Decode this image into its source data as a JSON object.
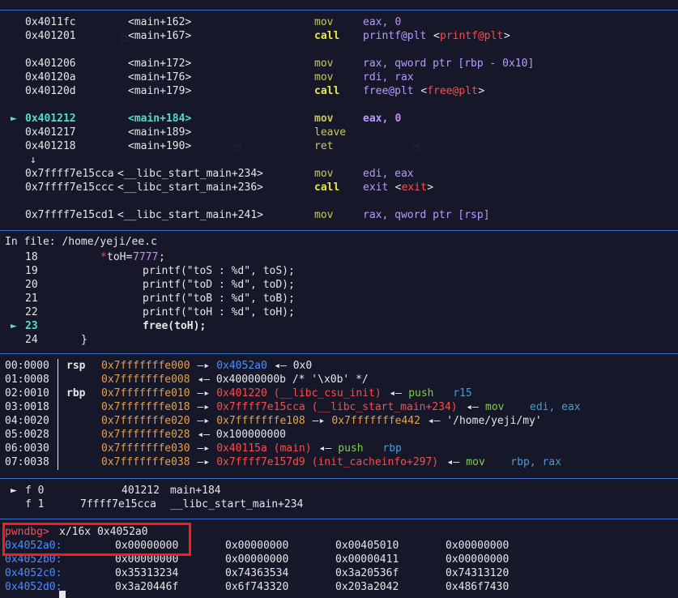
{
  "disasm": [
    {
      "marker": "",
      "addr": "0x4011fc",
      "sym": "<main+162>",
      "mn": "mov",
      "ops": "eax, 0",
      "kind": "mov0"
    },
    {
      "marker": "",
      "addr": "0x401201",
      "sym": "<main+167>",
      "mn": "call",
      "ops_a": "printf@plt",
      "ops_b": "<printf@plt>",
      "kind": "callp"
    },
    {
      "marker": "",
      "addr": "0x401206",
      "sym": "<main+172>",
      "mn": "mov",
      "ops": "rax, qword ptr [rbp - 0x10]",
      "kind": "plain"
    },
    {
      "marker": "",
      "addr": "0x40120a",
      "sym": "<main+176>",
      "mn": "mov",
      "ops": "rdi, rax",
      "kind": "plain"
    },
    {
      "marker": "",
      "addr": "0x40120d",
      "sym": "<main+179>",
      "mn": "call",
      "ops_a": "free@plt",
      "ops_b": "<free@plt>",
      "kind": "callp"
    },
    {
      "marker": "►",
      "addr": "0x401212",
      "sym": "<main+184>",
      "mn": "mov",
      "ops": "eax, 0",
      "kind": "cur"
    },
    {
      "marker": "",
      "addr": "0x401217",
      "sym": "<main+189>",
      "mn": "leave",
      "ops": "",
      "kind": "plain"
    },
    {
      "marker": "",
      "addr": "0x401218",
      "sym": "<main+190>",
      "mn": "ret",
      "ops": "",
      "kind": "plain"
    },
    {
      "marker": "",
      "addr": "↓",
      "sym": "",
      "mn": "",
      "ops": "",
      "kind": "arrow"
    },
    {
      "marker": "",
      "addr": "0x7ffff7e15cca",
      "sym": "<__libc_start_main+234>",
      "mn": "mov",
      "ops": "edi, eax",
      "kind": "plain"
    },
    {
      "marker": "",
      "addr": "0x7ffff7e15ccc",
      "sym": "<__libc_start_main+236>",
      "mn": "call",
      "ops_a": "exit",
      "ops_b": "<exit>",
      "kind": "callp"
    },
    {
      "marker": "",
      "addr": "0x7ffff7e15cd1",
      "sym": "<__libc_start_main+241>",
      "mn": "mov",
      "ops": "rax, qword ptr [rsp]",
      "kind": "plain"
    }
  ],
  "source": {
    "header": "In file: /home/yeji/ee.c",
    "lines": [
      {
        "marker": "",
        "no": "18",
        "text": "*toH=7777;",
        "kind": "assign"
      },
      {
        "marker": "",
        "no": "19",
        "text": "printf(\"toS : %d\", toS);",
        "kind": "plain"
      },
      {
        "marker": "",
        "no": "20",
        "text": "printf(\"toD : %d\", toD);",
        "kind": "plain"
      },
      {
        "marker": "",
        "no": "21",
        "text": "printf(\"toB : %d\", toB);",
        "kind": "plain"
      },
      {
        "marker": "",
        "no": "22",
        "text": "printf(\"toH : %d\", toH);",
        "kind": "plain"
      },
      {
        "marker": "►",
        "no": "23",
        "text": "free(toH);",
        "kind": "cur"
      },
      {
        "marker": "",
        "no": "24",
        "text": "}",
        "kind": "brace"
      }
    ]
  },
  "stack": [
    {
      "idx": "00:0000",
      "reg": "rsp",
      "addr": "0x7fffffffe000",
      "rest": [
        {
          "t": " —▸ ",
          "c": "white"
        },
        {
          "t": "0x4052a0",
          "c": "blue"
        },
        {
          "t": " ◂— 0x0",
          "c": "white"
        }
      ]
    },
    {
      "idx": "01:0008",
      "reg": "",
      "addr": "0x7fffffffe008",
      "rest": [
        {
          "t": " ◂— 0x40000000b /* '\\x0b' */",
          "c": "white"
        }
      ]
    },
    {
      "idx": "02:0010",
      "reg": "rbp",
      "addr": "0x7fffffffe010",
      "rest": [
        {
          "t": " —▸ ",
          "c": "white"
        },
        {
          "t": "0x401220 (__libc_csu_init)",
          "c": "red"
        },
        {
          "t": " ◂— ",
          "c": "white"
        },
        {
          "t": "push",
          "c": "green"
        },
        {
          "t": "   r15",
          "c": "cyan"
        }
      ]
    },
    {
      "idx": "03:0018",
      "reg": "",
      "addr": "0x7fffffffe018",
      "rest": [
        {
          "t": " —▸ ",
          "c": "white"
        },
        {
          "t": "0x7ffff7e15cca (__libc_start_main+234)",
          "c": "red"
        },
        {
          "t": " ◂— ",
          "c": "white"
        },
        {
          "t": "mov",
          "c": "green"
        },
        {
          "t": "    edi, eax",
          "c": "cyan"
        }
      ]
    },
    {
      "idx": "04:0020",
      "reg": "",
      "addr": "0x7fffffffe020",
      "rest": [
        {
          "t": " —▸ ",
          "c": "white"
        },
        {
          "t": "0x7fffffffe108",
          "c": "stack"
        },
        {
          "t": " —▸ ",
          "c": "white"
        },
        {
          "t": "0x7fffffffe442",
          "c": "stack"
        },
        {
          "t": " ◂— '/home/yeji/my'",
          "c": "white"
        }
      ]
    },
    {
      "idx": "05:0028",
      "reg": "",
      "addr": "0x7fffffffe028",
      "rest": [
        {
          "t": " ◂— 0x100000000",
          "c": "white"
        }
      ]
    },
    {
      "idx": "06:0030",
      "reg": "",
      "addr": "0x7fffffffe030",
      "rest": [
        {
          "t": " —▸ ",
          "c": "white"
        },
        {
          "t": "0x40115a (main)",
          "c": "red"
        },
        {
          "t": " ◂— ",
          "c": "white"
        },
        {
          "t": "push",
          "c": "green"
        },
        {
          "t": "   rbp",
          "c": "cyan"
        }
      ]
    },
    {
      "idx": "07:0038",
      "reg": "",
      "addr": "0x7fffffffe038",
      "rest": [
        {
          "t": " —▸ ",
          "c": "white"
        },
        {
          "t": "0x7ffff7e157d9 (init_cacheinfo+297)",
          "c": "red"
        },
        {
          "t": " ◂— ",
          "c": "white"
        },
        {
          "t": "mov",
          "c": "green"
        },
        {
          "t": "    rbp, rax",
          "c": "cyan"
        }
      ]
    }
  ],
  "backtrace": [
    {
      "marker": "►",
      "frame": "f 0",
      "addr": "401212",
      "sym": "main+184"
    },
    {
      "marker": "",
      "frame": "f 1",
      "addr": "7ffff7e15cca",
      "sym": "__libc_start_main+234"
    }
  ],
  "prompt": {
    "label": "pwndbg>",
    "command": "x/16x 0x4052a0"
  },
  "memory": [
    {
      "addr": "0x4052a0:",
      "vals": [
        "0x00000000",
        "0x00000000",
        "0x00405010",
        "0x00000000"
      ]
    },
    {
      "addr": "0x4052b0:",
      "vals": [
        "0x00000000",
        "0x00000000",
        "0x00000411",
        "0x00000000"
      ]
    },
    {
      "addr": "0x4052c0:",
      "vals": [
        "0x35313234",
        "0x74363534",
        "0x3a20536f",
        "0x74313120"
      ]
    },
    {
      "addr": "0x4052d0:",
      "vals": [
        "0x3a20446f",
        "0x6f743320",
        "0x203a2042",
        "0x486f7430"
      ]
    }
  ],
  "colors": {
    "bg": "#16182a",
    "separator": "#3b6cc9",
    "highlight_box": "#ff1a1a"
  }
}
